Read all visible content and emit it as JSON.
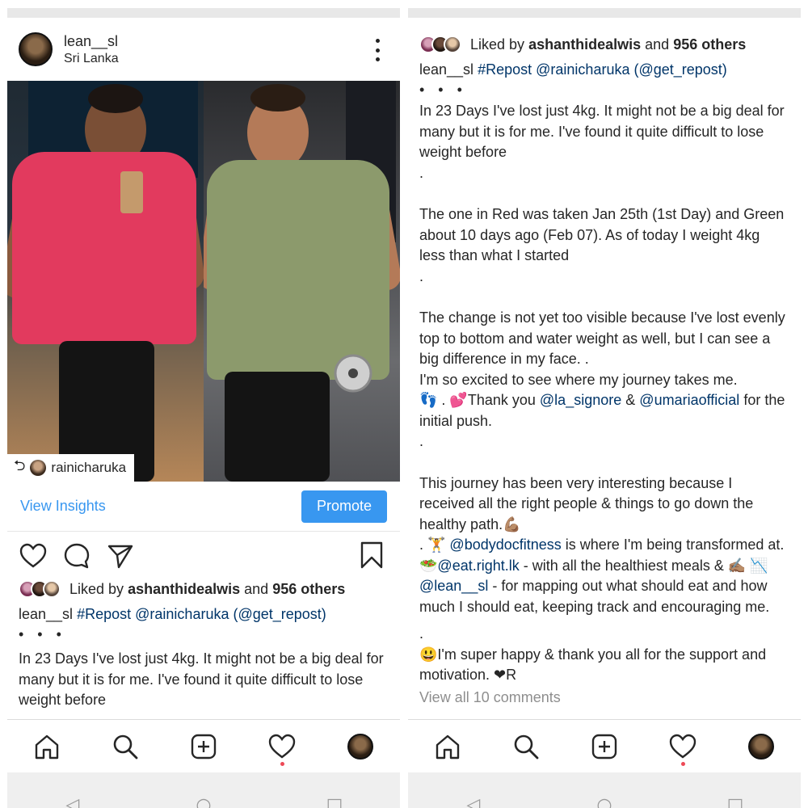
{
  "post": {
    "username": "lean__sl",
    "location": "Sri Lanka",
    "repost_tag_name": "rainicharuka",
    "insights_label": "View Insights",
    "promote_label": "Promote",
    "likes": {
      "prefix": "Liked by",
      "user": "ashanthidealwis",
      "middle": "and",
      "count_text": "956 others"
    },
    "caption": {
      "username": "lean__sl",
      "hashtag": "#Repost",
      "mention": "@rainicharuka",
      "via": "(@get_repost)",
      "dots": "• • •",
      "p1": "In 23 Days I've lost just 4kg. It might not be a big deal for many but it is for me. I've found it quite difficult to lose weight before",
      "sep": ".",
      "p2": "The one in Red was taken Jan 25th (1st Day) and Green about 10 days ago (Feb 07). As of today I weight 4kg less than what I started",
      "p3": "The change is not yet too visible because I've lost evenly top to bottom and water weight as well, but  I can see a big difference in my face. .",
      "p4": "I'm so excited to see where my journey takes me.",
      "p5_pre": "👣 . 💕Thank you",
      "p5_m1": "@la_signore",
      "p5_amp": "&",
      "p5_m2": "@umariaofficial",
      "p5_post": "for the initial push.",
      "p6": "This journey has been very interesting because I received all the right people & things to go down the healthy path.💪🏽",
      "p7_pre": ". 🏋 ",
      "p7_m1": "@bodydocfitness",
      "p7_mid1": "is where I'm being transformed at. 🥗",
      "p7_m2": "@eat.right.lk",
      "p7_mid2": "- with all the healthiest meals & ✍🏽 📉",
      "p7_m3": "@lean__sl",
      "p7_end": "- for mapping out what should eat and how much I should eat, keeping track and encouraging me.",
      "p8": "😃I'm super happy & thank you all for the support and motivation. ❤R",
      "view_comments": "View all 10 comments"
    }
  },
  "icons": {
    "more": "more-vertical-icon",
    "repost": "repost-icon",
    "like": "heart-icon",
    "comment": "comment-icon",
    "share": "direct-share-icon",
    "save": "bookmark-icon",
    "nav": [
      "home-icon",
      "search-icon",
      "add-post-icon",
      "activity-heart-icon",
      "profile-avatar"
    ]
  },
  "colors": {
    "link_blue": "#3897f0",
    "mention_blue": "#003569",
    "notification_red": "#ed4956",
    "shirt_red": "#e23a5e",
    "shirt_green": "#8c9a6c"
  }
}
